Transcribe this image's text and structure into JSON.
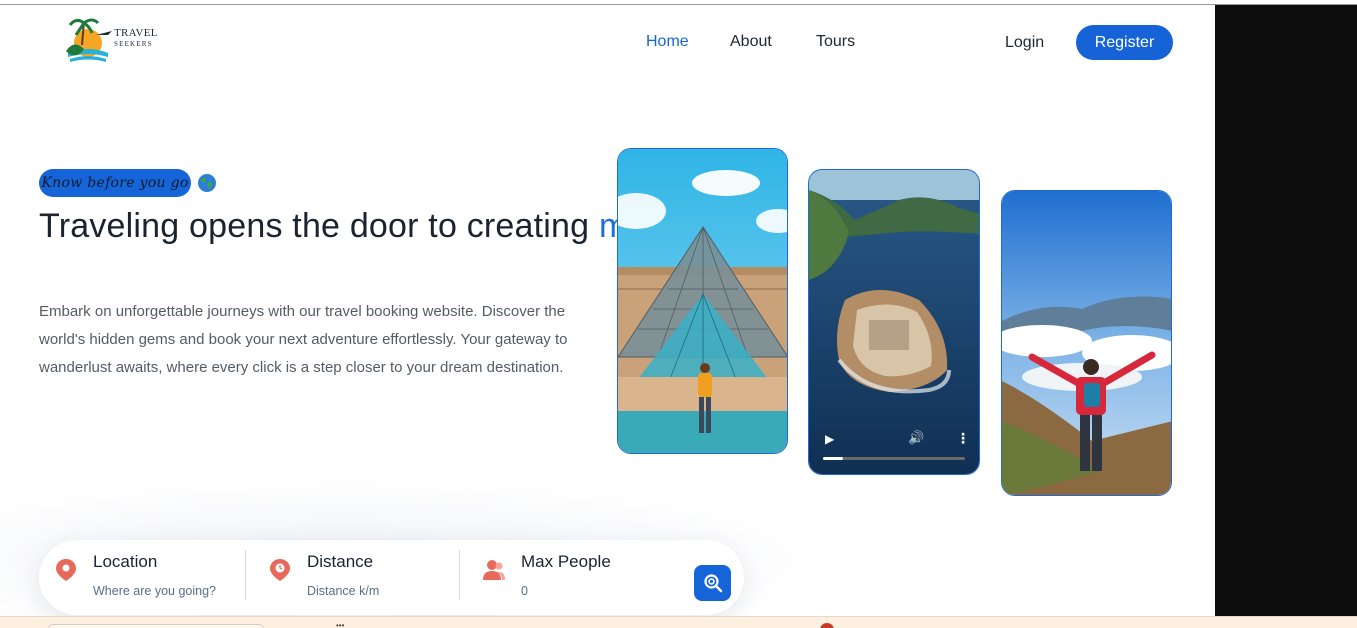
{
  "brand": {
    "line1": "TRAVEL",
    "line2": "SEEKERS"
  },
  "nav": {
    "items": [
      {
        "label": "Home",
        "active": true
      },
      {
        "label": "About",
        "active": false
      },
      {
        "label": "Tours",
        "active": false
      }
    ],
    "login_label": "Login",
    "register_label": "Register"
  },
  "hero": {
    "badge": "Know before you go",
    "badge_icon": "globe-emoji",
    "headline_part1": "Traveling opens the door to creating",
    "headline_accent": "memories",
    "description": "Embark on unforgettable journeys with our travel booking website. Discover the world's hidden gems and book your next adventure effortlessly. Your gateway to wanderlust awaits, where every click is a step closer to your dream destination."
  },
  "media": {
    "video_progress": 0.14
  },
  "search": {
    "fields": [
      {
        "title": "Location",
        "placeholder": "Where are you going?",
        "icon": "map-pin-icon"
      },
      {
        "title": "Distance",
        "placeholder": "Distance k/m",
        "icon": "distance-pin-icon"
      },
      {
        "title": "Max People",
        "placeholder": "0",
        "icon": "people-icon"
      }
    ],
    "button_icon": "search-icon"
  },
  "colors": {
    "accent": "#1565d8",
    "heading": "#1b2230",
    "icon_red": "#e66a5c"
  }
}
